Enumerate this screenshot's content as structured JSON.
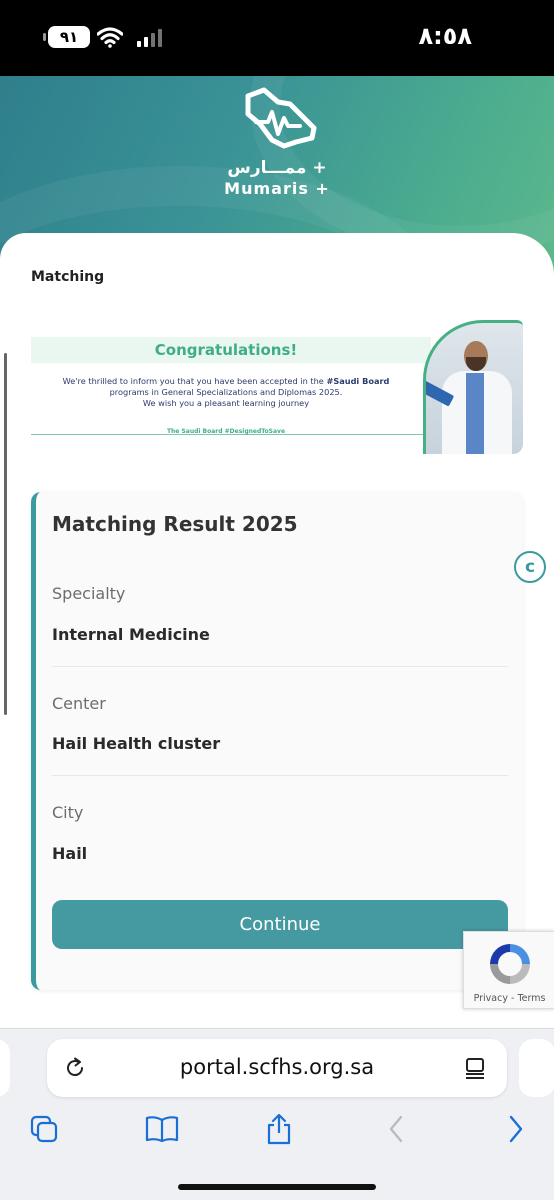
{
  "status_bar": {
    "battery": "٩١",
    "time": "٨:٥٨"
  },
  "header": {
    "logo_arabic": "ممـــارس +",
    "logo_english": "Mumaris +"
  },
  "page": {
    "section_title": "Matching",
    "banner": {
      "heading": "Congratulations!",
      "line1_prefix": "We're thrilled to inform you that you have been accepted in the ",
      "line1_hashtag": "#Saudi Board",
      "line2": "programs in General Specializations and Diplomas 2025.",
      "line3": "We wish you a pleasant learning journey",
      "tagline": "The Saudi Board #DesignedToSave"
    },
    "result": {
      "title": "Matching Result 2025",
      "fields": [
        {
          "label": "Specialty",
          "value": "Internal Medicine"
        },
        {
          "label": "Center",
          "value": "Hail Health cluster"
        },
        {
          "label": "City",
          "value": "Hail"
        }
      ],
      "continue_label": "Continue"
    },
    "recaptcha_links": "Privacy - Terms"
  },
  "browser": {
    "url": "portal.scfhs.org.sa"
  },
  "colors": {
    "accent": "#4599a1",
    "header_start": "#2f7f8c",
    "header_end": "#5cb98c",
    "congrats_green": "#3fae85",
    "link_blue": "#1a6fd6"
  }
}
